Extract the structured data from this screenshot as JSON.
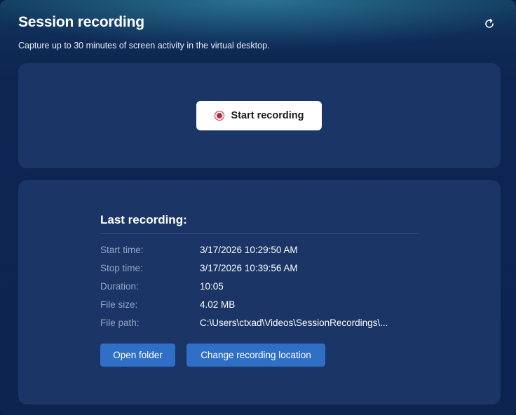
{
  "header": {
    "title": "Session recording",
    "subtitle": "Capture up to 30 minutes of screen activity in the virtual desktop.",
    "refresh_icon": "refresh-icon"
  },
  "record_panel": {
    "start_label": "Start recording",
    "record_icon": "record-icon",
    "record_color": "#c4243a"
  },
  "last_recording": {
    "title": "Last recording:",
    "rows": [
      {
        "label": "Start time:",
        "value": "3/17/2026 10:29:50 AM"
      },
      {
        "label": "Stop time:",
        "value": "3/17/2026 10:39:56 AM"
      },
      {
        "label": "Duration:",
        "value": "10:05"
      },
      {
        "label": "File size:",
        "value": "4.02 MB"
      },
      {
        "label": "File path:",
        "value": "C:\\Users\\ctxad\\Videos\\SessionRecordings\\..."
      }
    ],
    "open_folder_label": "Open folder",
    "change_location_label": "Change recording location"
  },
  "colors": {
    "accent_button": "#2f6fc6",
    "card_background": "#1a3566"
  }
}
